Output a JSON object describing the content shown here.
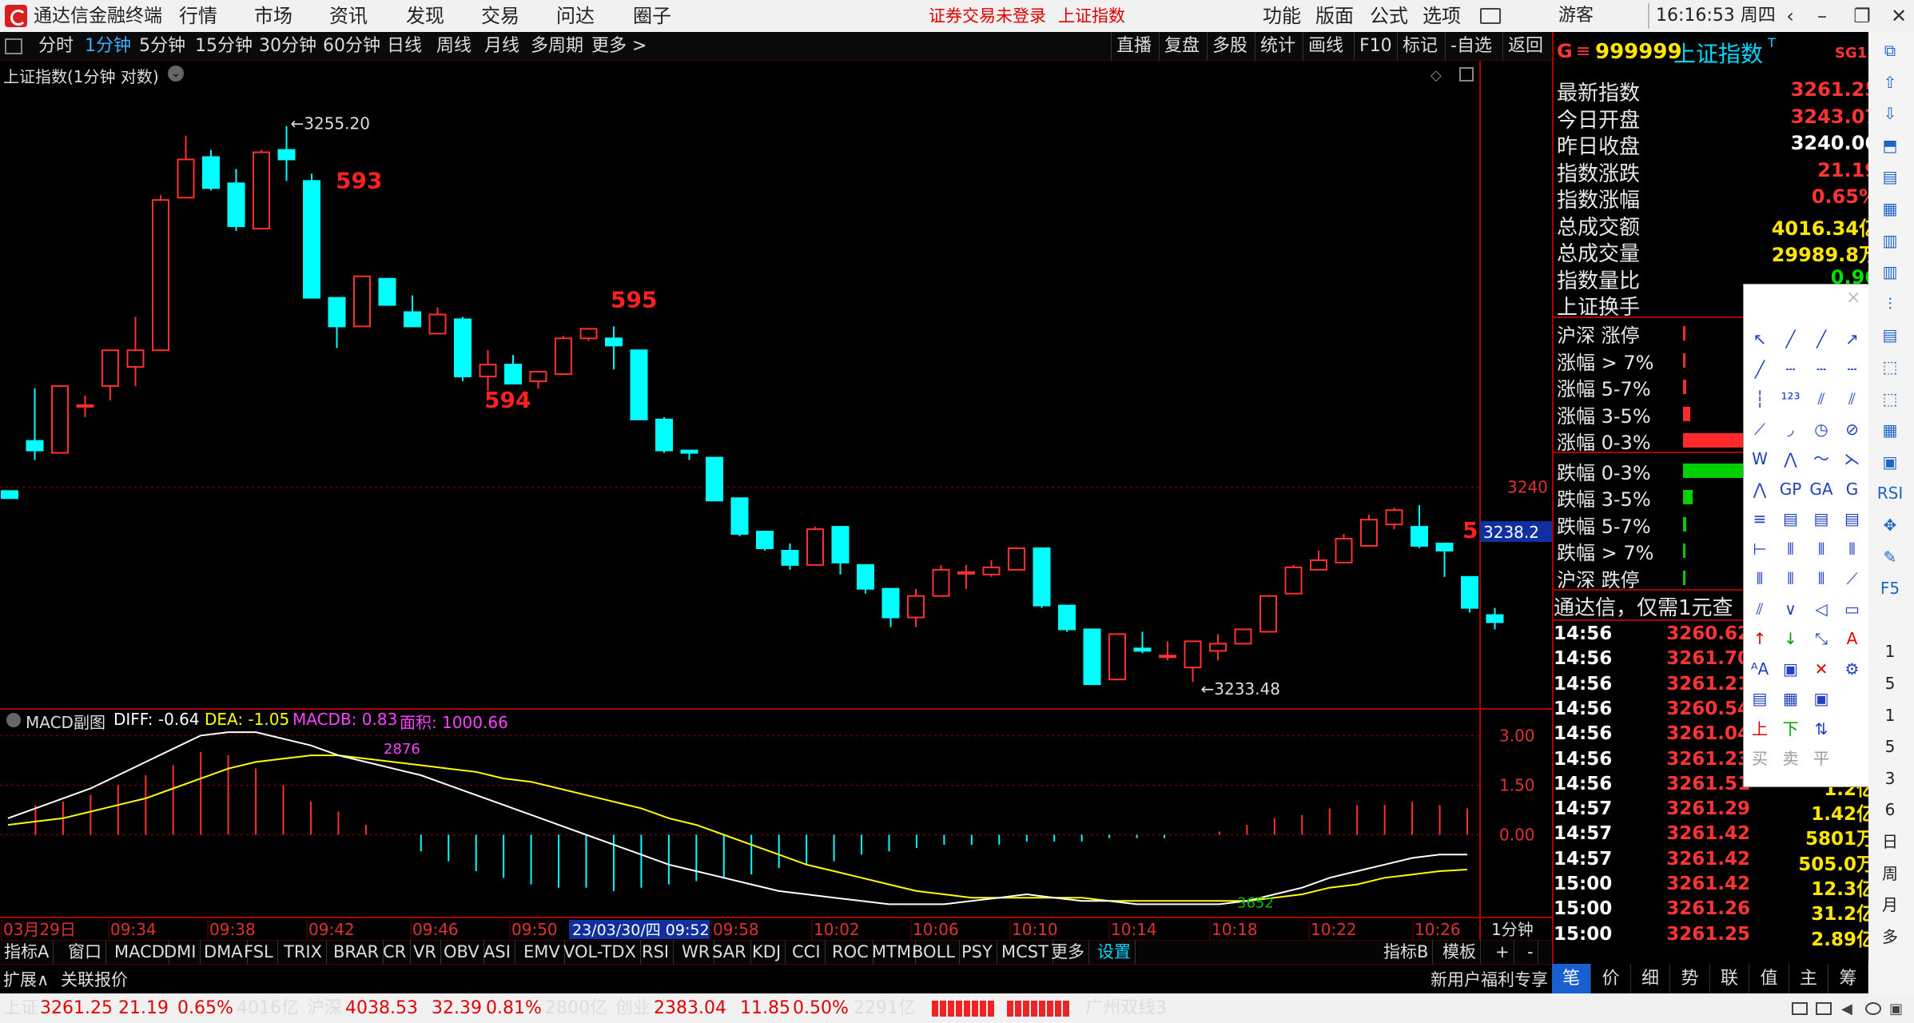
{
  "app": {
    "title": "通达信金融终端",
    "menu": [
      "行情",
      "市场",
      "资讯",
      "发现",
      "交易",
      "问达",
      "圈子"
    ],
    "notice": "证券交易未登录",
    "index_link": "上证指数",
    "menu_right": [
      "功能",
      "版面",
      "公式",
      "选项"
    ],
    "guest": "游客",
    "clock": "16:16:53 周四"
  },
  "periods": [
    "分时",
    "1分钟",
    "5分钟",
    "15分钟",
    "30分钟",
    "60分钟",
    "日线",
    "周线",
    "月线",
    "多周期",
    "更多 >"
  ],
  "active_period": "1分钟",
  "chart_tools": [
    "直播",
    "复盘",
    "多股",
    "统计",
    "画线",
    "F10",
    "标记",
    "-自选",
    "返回"
  ],
  "chart_title": "上证指数(1分钟 对数)",
  "quote": {
    "code": "999999",
    "name": "上证指数",
    "superscript": "T",
    "tag": "SG1",
    "g_label": "G",
    "rows": [
      {
        "label": "最新指数",
        "value": "3261.25",
        "color": "#ff3434"
      },
      {
        "label": "今日开盘",
        "value": "3243.07",
        "color": "#ff3434"
      },
      {
        "label": "昨日收盘",
        "value": "3240.06",
        "color": "#ffffff"
      },
      {
        "label": "指数涨跌",
        "value": "21.19",
        "color": "#ff3434"
      },
      {
        "label": "指数涨幅",
        "value": "0.65%",
        "color": "#ff3434"
      },
      {
        "label": "总成交额",
        "value": "4016.34亿",
        "color": "#ffe600"
      },
      {
        "label": "总成交量",
        "value": "29989.8万",
        "color": "#ffe600"
      },
      {
        "label": "指数量比",
        "value": "0.96",
        "color": "#00e000"
      },
      {
        "label": "上证换手",
        "value": "",
        "color": "#ffffff"
      }
    ],
    "breadth": [
      {
        "label": "沪深 涨停",
        "bar": 0.02,
        "color": "#ff2a2a"
      },
      {
        "label": "涨幅 > 7%",
        "bar": 0.02,
        "color": "#ff2a2a"
      },
      {
        "label": "涨幅 5-7%",
        "bar": 0.04,
        "color": "#ff2a2a"
      },
      {
        "label": "涨幅 3-5%",
        "bar": 0.1,
        "color": "#ff2a2a"
      },
      {
        "label": "涨幅 0-3%",
        "bar": 1.0,
        "color": "#ff2a2a"
      },
      {
        "label": "跌幅 0-3%",
        "bar": 1.0,
        "color": "#00d000"
      },
      {
        "label": "跌幅 3-5%",
        "bar": 0.13,
        "color": "#00d000"
      },
      {
        "label": "跌幅 5-7%",
        "bar": 0.04,
        "color": "#00d000"
      },
      {
        "label": "跌幅 > 7%",
        "bar": 0.02,
        "color": "#00d000"
      },
      {
        "label": "沪深 跌停",
        "bar": 0.02,
        "color": "#00d000"
      }
    ],
    "promo": "通达信，仅需1元查",
    "ticks": [
      {
        "time": "14:56",
        "price": "3260.62",
        "vol": ""
      },
      {
        "time": "14:56",
        "price": "3261.70",
        "vol": ""
      },
      {
        "time": "14:56",
        "price": "3261.21",
        "vol": ""
      },
      {
        "time": "14:56",
        "price": "3260.54",
        "vol": ""
      },
      {
        "time": "14:56",
        "price": "3261.04",
        "vol": ""
      },
      {
        "time": "14:56",
        "price": "3261.23",
        "vol": ""
      },
      {
        "time": "14:56",
        "price": "3261.51",
        "vol": "1.2亿"
      },
      {
        "time": "14:57",
        "price": "3261.29",
        "vol": "1.42亿"
      },
      {
        "time": "14:57",
        "price": "3261.42",
        "vol": "5801万"
      },
      {
        "time": "14:57",
        "price": "3261.42",
        "vol": "505.0万"
      },
      {
        "time": "15:00",
        "price": "3261.42",
        "vol": "12.3亿"
      },
      {
        "time": "15:00",
        "price": "3261.26",
        "vol": "31.2亿"
      },
      {
        "time": "15:00",
        "price": "3261.25",
        "vol": "2.89亿"
      }
    ],
    "tabs": [
      "笔",
      "价",
      "细",
      "势",
      "联",
      "值",
      "主",
      "筹"
    ]
  },
  "chart_data": {
    "type": "candlestick",
    "price_axis": {
      "ticks": [
        "3240"
      ],
      "current": "3238.2",
      "ylim": [
        3231,
        3257
      ]
    },
    "annotations": {
      "high": "3255.20",
      "low": "3233.48",
      "labels": [
        "593",
        "594",
        "595",
        "5"
      ]
    },
    "candles": [
      [
        3239.9,
        3239.9,
        3239.6,
        3239.6
      ],
      [
        3242.0,
        3244.2,
        3241.2,
        3241.6
      ],
      [
        3241.5,
        3244.3,
        3241.5,
        3244.3
      ],
      [
        3243.5,
        3243.9,
        3243.0,
        3243.5
      ],
      [
        3244.3,
        3245.5,
        3243.7,
        3245.8
      ],
      [
        3245.1,
        3247.2,
        3244.3,
        3245.8
      ],
      [
        3245.8,
        3252.3,
        3245.8,
        3252.1
      ],
      [
        3252.2,
        3254.8,
        3252.2,
        3253.8
      ],
      [
        3253.9,
        3254.2,
        3252.5,
        3252.6
      ],
      [
        3252.8,
        3253.4,
        3250.8,
        3251.0
      ],
      [
        3250.9,
        3254.2,
        3250.9,
        3254.1
      ],
      [
        3254.2,
        3255.2,
        3252.9,
        3253.8
      ],
      [
        3252.9,
        3253.2,
        3248.0,
        3248.0
      ],
      [
        3248.0,
        3248.0,
        3245.9,
        3246.8
      ],
      [
        3246.8,
        3248.7,
        3246.8,
        3248.9
      ],
      [
        3248.8,
        3248.8,
        3247.7,
        3247.7
      ],
      [
        3247.4,
        3248.1,
        3246.9,
        3246.8
      ],
      [
        3246.5,
        3247.6,
        3246.5,
        3247.3
      ],
      [
        3247.1,
        3247.2,
        3244.5,
        3244.7
      ],
      [
        3244.7,
        3245.8,
        3244.1,
        3245.2
      ],
      [
        3245.2,
        3245.6,
        3244.5,
        3244.4
      ],
      [
        3244.5,
        3244.8,
        3244.2,
        3244.9
      ],
      [
        3244.8,
        3246.4,
        3244.8,
        3246.3
      ],
      [
        3246.3,
        3246.7,
        3246.2,
        3246.7
      ],
      [
        3246.3,
        3246.8,
        3245.0,
        3246.0
      ],
      [
        3245.8,
        3245.8,
        3242.9,
        3242.9
      ],
      [
        3242.9,
        3243.0,
        3241.5,
        3241.6
      ],
      [
        3241.6,
        3241.6,
        3241.2,
        3241.5
      ],
      [
        3241.3,
        3241.3,
        3239.5,
        3239.5
      ],
      [
        3239.6,
        3239.6,
        3238.0,
        3238.1
      ],
      [
        3238.2,
        3238.2,
        3237.4,
        3237.5
      ],
      [
        3237.4,
        3237.7,
        3236.6,
        3236.8
      ],
      [
        3236.8,
        3238.4,
        3236.8,
        3238.3
      ],
      [
        3238.4,
        3238.4,
        3236.4,
        3236.9
      ],
      [
        3236.8,
        3236.8,
        3235.6,
        3235.8
      ],
      [
        3235.8,
        3235.8,
        3234.2,
        3234.6
      ],
      [
        3234.6,
        3235.8,
        3234.2,
        3235.5
      ],
      [
        3235.5,
        3236.8,
        3235.5,
        3236.6
      ],
      [
        3236.5,
        3236.8,
        3235.8,
        3236.5
      ],
      [
        3236.4,
        3237.0,
        3236.3,
        3236.7
      ],
      [
        3236.6,
        3237.4,
        3236.6,
        3237.5
      ],
      [
        3237.5,
        3237.5,
        3235.0,
        3235.1
      ],
      [
        3235.1,
        3235.1,
        3234.0,
        3234.1
      ],
      [
        3234.1,
        3234.1,
        3231.8,
        3231.8
      ],
      [
        3232.0,
        3233.9,
        3232.0,
        3233.9
      ],
      [
        3233.3,
        3234.0,
        3233.1,
        3233.2
      ],
      [
        3233.0,
        3233.6,
        3232.8,
        3233.0
      ],
      [
        3232.5,
        3233.5,
        3231.9,
        3233.6
      ],
      [
        3233.2,
        3233.9,
        3232.8,
        3233.5
      ],
      [
        3233.5,
        3234.0,
        3233.5,
        3234.1
      ],
      [
        3234.0,
        3235.3,
        3234.0,
        3235.5
      ],
      [
        3235.6,
        3236.8,
        3235.6,
        3236.7
      ],
      [
        3236.6,
        3237.4,
        3236.6,
        3237.0
      ],
      [
        3236.9,
        3238.1,
        3236.9,
        3237.9
      ],
      [
        3237.6,
        3238.9,
        3237.6,
        3238.7
      ],
      [
        3238.5,
        3239.2,
        3238.3,
        3239.1
      ],
      [
        3238.4,
        3239.3,
        3237.5,
        3237.6
      ],
      [
        3237.7,
        3237.7,
        3236.3,
        3237.4
      ],
      [
        3236.3,
        3236.3,
        3234.8,
        3235.0
      ],
      [
        3234.7,
        3235.0,
        3234.1,
        3234.4
      ]
    ],
    "macd": {
      "title": "MACD副图",
      "diff": "DIFF: -0.64",
      "dea": "DEA: -1.05",
      "macdb": "MACDB: 0.83",
      "area": "面积: 1000.66",
      "axis_ticks": [
        "3.00",
        "1.50",
        "0.00"
      ],
      "ylim": [
        -2.5,
        3.2
      ],
      "peak_label": "2876",
      "trough_label": "3652",
      "diff_values": [
        0.5,
        0.8,
        1.1,
        1.4,
        1.8,
        2.2,
        2.6,
        3.0,
        3.1,
        3.1,
        2.9,
        2.7,
        2.4,
        2.2,
        2.0,
        1.8,
        1.5,
        1.2,
        0.9,
        0.6,
        0.3,
        0.0,
        -0.3,
        -0.6,
        -0.9,
        -1.1,
        -1.3,
        -1.5,
        -1.7,
        -1.8,
        -1.9,
        -2.0,
        -2.1,
        -2.1,
        -2.1,
        -2.0,
        -1.9,
        -1.8,
        -1.9,
        -2.0,
        -2.0,
        -2.1,
        -2.1,
        -2.1,
        -2.1,
        -2.0,
        -1.8,
        -1.6,
        -1.3,
        -1.1,
        -0.9,
        -0.7,
        -0.6,
        -0.6
      ],
      "dea_values": [
        0.3,
        0.4,
        0.5,
        0.7,
        0.9,
        1.1,
        1.4,
        1.7,
        2.0,
        2.2,
        2.3,
        2.4,
        2.4,
        2.3,
        2.2,
        2.1,
        2.0,
        1.9,
        1.7,
        1.6,
        1.4,
        1.2,
        1.0,
        0.8,
        0.5,
        0.3,
        0.0,
        -0.3,
        -0.6,
        -0.9,
        -1.1,
        -1.3,
        -1.5,
        -1.7,
        -1.8,
        -1.9,
        -1.9,
        -1.9,
        -1.9,
        -1.9,
        -2.0,
        -2.0,
        -2.0,
        -2.0,
        -2.0,
        -2.0,
        -1.9,
        -1.8,
        -1.6,
        -1.5,
        -1.3,
        -1.2,
        -1.1,
        -1.05
      ],
      "bar_values": [
        0.0,
        0.9,
        1.0,
        1.2,
        1.5,
        1.8,
        2.1,
        2.5,
        2.4,
        2.0,
        1.5,
        1.0,
        0.7,
        0.3,
        0.0,
        -0.5,
        -0.8,
        -1.1,
        -1.3,
        -1.5,
        -1.6,
        -1.6,
        -1.7,
        -1.6,
        -1.5,
        -1.4,
        -1.3,
        -1.2,
        -1.0,
        -0.9,
        -0.8,
        -0.6,
        -0.5,
        -0.4,
        -0.3,
        -0.3,
        -0.3,
        -0.2,
        -0.2,
        -0.2,
        -0.1,
        -0.1,
        -0.1,
        0.0,
        0.1,
        0.3,
        0.5,
        0.6,
        0.8,
        0.9,
        0.9,
        1.0,
        0.9,
        0.8
      ]
    },
    "x_labels": [
      "03月29日",
      "09:34",
      "09:38",
      "09:42",
      "09:46",
      "09:50",
      "09:58",
      "10:02",
      "10:06",
      "10:10",
      "10:14",
      "10:18",
      "10:22",
      "10:26"
    ],
    "cursor_label": "23/03/30/四 09:52",
    "period_label": "1分钟"
  },
  "indicator_tabs": [
    "指标A",
    "窗口",
    "MACD",
    "DMI",
    "DMA",
    "FSL",
    "TRIX",
    "BRAR",
    "CR",
    "VR",
    "OBV",
    "ASI",
    "EMV",
    "VOL-TDX",
    "RSI",
    "WR",
    "SAR",
    "KDJ",
    "CCI",
    "ROC",
    "MTM",
    "BOLL",
    "PSY",
    "MCST",
    "更多",
    "设置"
  ],
  "indicator_right": [
    "指标B",
    "模板",
    "+",
    "-"
  ],
  "ext_tabs": [
    "扩展∧",
    "关联报价"
  ],
  "ext_right": "新用户福利专享",
  "status": {
    "sh_label": "上证",
    "sh_price": "3261.25",
    "sh_chg": "21.19",
    "sh_pct": "0.65%",
    "sh_amt": "4016亿",
    "hs_label": "沪深",
    "hs_price": "4038.53",
    "hs_chg": "32.39",
    "hs_pct": "0.81%",
    "hs_amt": "2800亿",
    "cy_label": "创业",
    "cy_price": "2383.04",
    "cy_chg": "11.85",
    "cy_pct": "0.50%",
    "cy_amt": "2291亿",
    "server": "广州双线3"
  },
  "colors": {
    "up": "#ff3030",
    "down": "#00ffff",
    "diff": "#ffffff",
    "dea": "#ffff00",
    "grid": "#8a0000"
  }
}
